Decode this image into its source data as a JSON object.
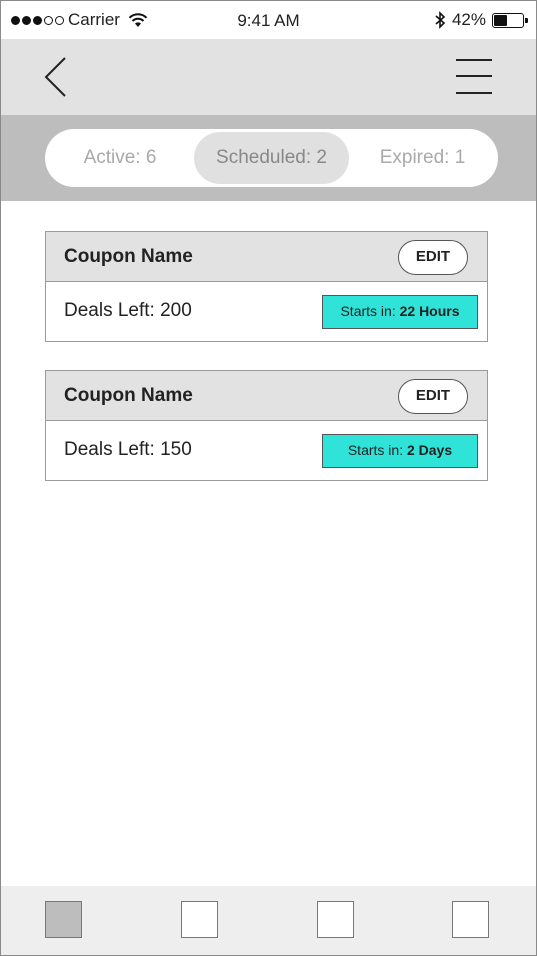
{
  "status_bar": {
    "carrier": "Carrier",
    "time": "9:41 AM",
    "battery": "42%",
    "battery_level": 0.42
  },
  "tabs": [
    {
      "label": "Active: 6",
      "selected": false
    },
    {
      "label": "Scheduled: 2",
      "selected": true
    },
    {
      "label": "Expired: 1",
      "selected": false
    }
  ],
  "coupons": [
    {
      "name": "Coupon Name",
      "edit_label": "EDIT",
      "deals_left": "Deals Left: 200",
      "starts_prefix": "Starts in:",
      "starts_value": "22 Hours"
    },
    {
      "name": "Coupon Name",
      "edit_label": "EDIT",
      "deals_left": "Deals Left: 150",
      "starts_prefix": "Starts in:",
      "starts_value": "2 Days"
    }
  ],
  "colors": {
    "accent": "#2fe3d8",
    "header_gray": "#e2e2e2",
    "tab_band": "#bdbdbd"
  },
  "bottom_nav": {
    "selected_index": 0,
    "count": 4
  }
}
